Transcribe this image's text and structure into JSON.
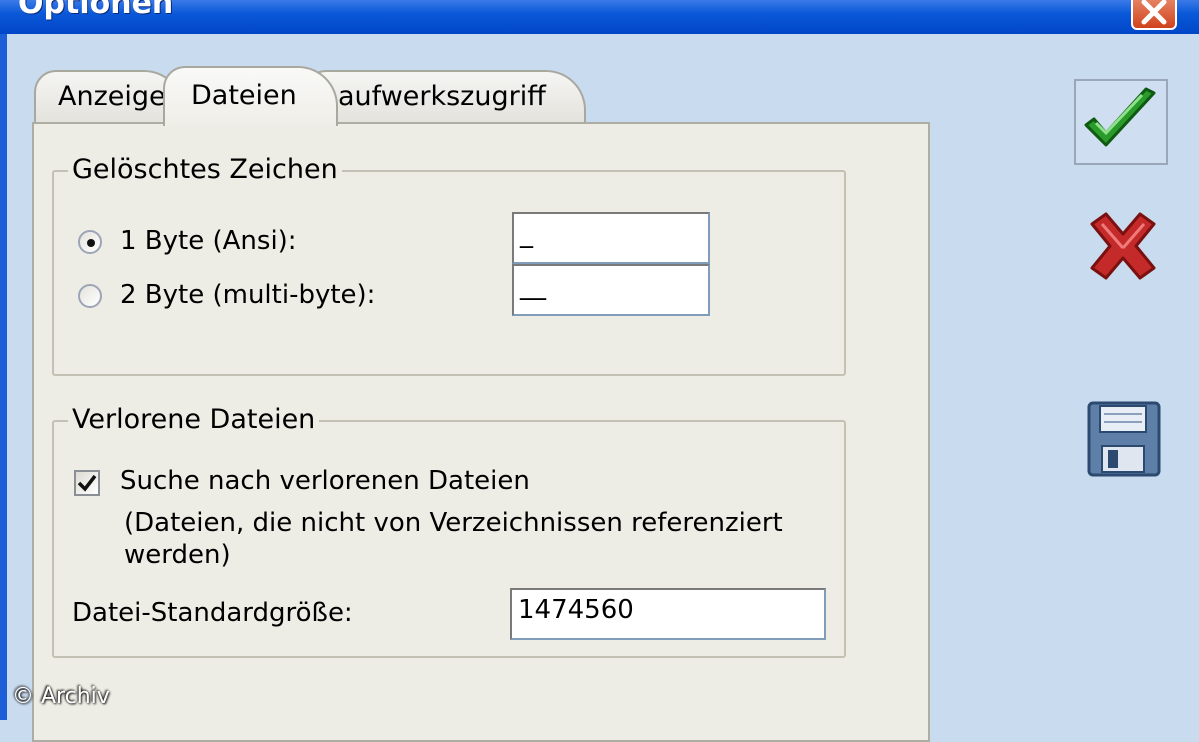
{
  "window": {
    "title": "Optionen"
  },
  "tabs": [
    {
      "label": "Anzeige"
    },
    {
      "label": "Dateien"
    },
    {
      "label": "aufwerkszugriff"
    }
  ],
  "deleted_char": {
    "title": "Gelöschtes Zeichen",
    "option1": {
      "label": "1 Byte (Ansi):",
      "selected": true,
      "value": "_"
    },
    "option2": {
      "label": "2 Byte (multi-byte):",
      "selected": false,
      "value": "__"
    }
  },
  "lost_files": {
    "title": "Verlorene Dateien",
    "checkbox_label": "Suche nach verlorenen Dateien",
    "checked": true,
    "note_line1": "(Dateien, die nicht von Verzeichnissen referenziert",
    "note_line2": "werden)",
    "size_label": "Datei-Standardgröße:",
    "size_value": "1474560"
  },
  "side_buttons": [
    "ok-check-icon",
    "cancel-x-icon",
    "save-disk-icon"
  ],
  "watermark": "© Archiv"
}
